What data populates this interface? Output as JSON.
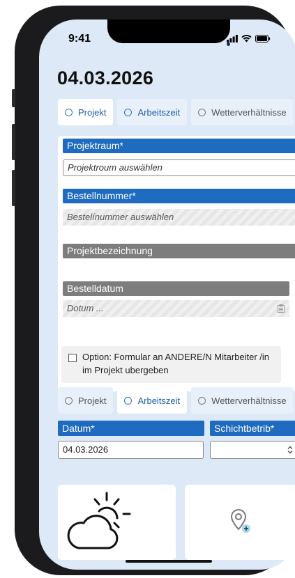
{
  "status": {
    "time": "9:41"
  },
  "page": {
    "title": "04.03.2026"
  },
  "tabs_top": [
    {
      "label": "Projekt"
    },
    {
      "label": "Arbeitszeit"
    },
    {
      "label": "Wetterverhältnisse"
    }
  ],
  "form": {
    "projektraum_label": "Projektraum*",
    "projektraum_value": "Projektroum auswählen",
    "bestellnummer_label": "Bestellnummer*",
    "bestellnummer_value": "Bestelínummer auswählen",
    "projektbezeichnung_label": "Projektbezeichnung",
    "bestelldatum_label": "Bestelldatum",
    "bestelldatum_value": "Dotum ...",
    "option_text": "Option: Formular an ANDERE/N Mitarbeiter /in im Projekt ubergeben"
  },
  "tabs_bottom": [
    {
      "label": "Projekt"
    },
    {
      "label": "Arbeitszeit"
    },
    {
      "label": "Wetterverhältnisse"
    }
  ],
  "fields": {
    "datum_label": "Datum*",
    "datum_value": "04.03.2026",
    "schicht_label": "Schichtbetrib*",
    "schicht_value": ""
  },
  "icons": [
    "signal-icon",
    "wifi-icon",
    "battery-icon",
    "calendar-icon",
    "select-arrows-icon",
    "weather-icon",
    "add-location-icon"
  ]
}
